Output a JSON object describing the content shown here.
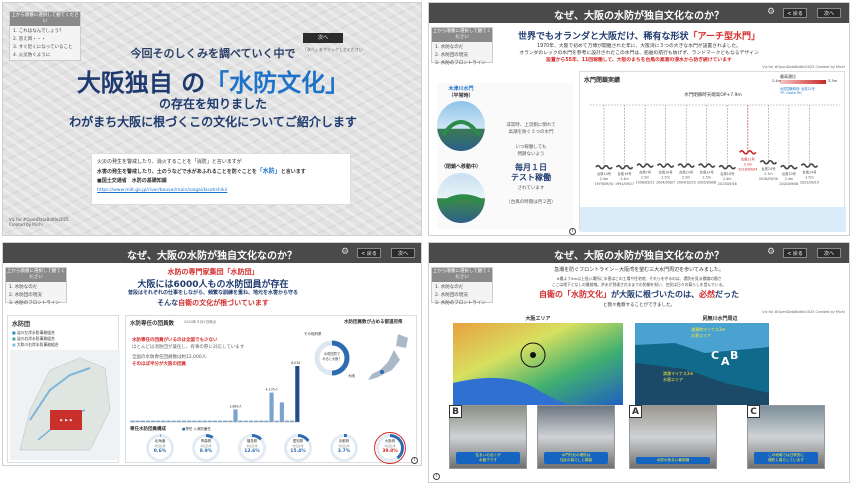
{
  "quiz": {
    "title": "上から順番に選択して\n観てください",
    "title_short": "上から順番に選択して観てください",
    "opts_s1": [
      "1. これはなんでしょう？",
      "2. 答え目・・・",
      "3. すぐ近くになっていること",
      "4. 火災防ぐように"
    ],
    "opts": [
      "1. 水防なのだ",
      "2. 水防団の現況",
      "3. 水防のフロントライン"
    ]
  },
  "s1": {
    "lead": "今回そのしくみを調べていく中で",
    "title_a": "大阪独自 の",
    "title_b": "「水防文化」",
    "sub": "の存在を知りました",
    "tagline": "わがまち大阪に根づくこの文化についてご紹介します",
    "p1": "火災の発生を警戒したり、消火することを「消防」と言いますが",
    "p2a": "水害の発生を警戒したり、土のうなどで水があふれることを防ぐことを",
    "p2b": "「水防」",
    "p2c": "と言います",
    "src": "■国土交通省　水防の基礎知識",
    "url": "https://www.mlit.go.jp/river/bousai/main/saigai/kisotishiki/",
    "credit": "Viz for #OpenDataBattle2025\nCreated by Michi",
    "next": "次へ",
    "next_hint": "「次へ」をクリックしてください"
  },
  "s2": {
    "header": "なぜ、大阪の水防が独自文化なのか？",
    "back": "< 戻る",
    "next": "次へ",
    "h_a": "世界でもオランダと大阪だけ、稀有な形状",
    "h_b": "「アーチ型水門」",
    "l1": "1970年、大阪で初めて万博が開催された年に、大阪湾に３つの大きな水門が設置されました。",
    "l2": "オランダのレックの水門を参考に設計されたこの水門は、船舶の航行も妨げず、ランドマークともなるデザイン",
    "l3": "設置から55年、11回稼働して、大阪のまちを台風の高潮の浸水から防ぎ続けています",
    "credit": "Viz for #OpenDataBattle2025 Created by Michi",
    "gate_name": "木津川水門",
    "gate_state_a": "（平常時）",
    "gate_state_b": "（閉鎖へ移動中）",
    "desc1": "非常時、上流側に倒れて\n高潮を防ぐ３つの水門",
    "desc2": "いつ稼働しても\n問題ないよう",
    "big": "毎月１日\nテスト稼働",
    "desc3": "されています",
    "desc4": "（台風の時期は月２回）",
    "chart_title": "水門閉鎖実績",
    "legend_title": "最高潮位",
    "legend_hi": "3.3m",
    "legend_lo": "2.4m",
    "note": "水防閉鎖時刻: 台風21号\nTP: Osaka Pel.",
    "line_label": "水門閉鎖時天端高OP+7.9m"
  },
  "s2chart": {
    "type": "bar",
    "title": "水門閉鎖実績",
    "labels": [
      "台風10号\n2.4m\n1979/09/30",
      "台風19号\n2.4m\n1991/09/27",
      "台風7号\n2.5m\n1998/09/22",
      "台風18号\n2.5m\n2004/09/07",
      "台風23号\n2.5m\n2004/10/20",
      "台風14号\n2.5m\n2005/09/06",
      "台風18号\n2.4m\n2013/09/16",
      "台風21号\n3.3m\n2018/09/04",
      "台風24号\n2.7m\n2018/09/30",
      "台風10号\n2.4m\n2020/09/06",
      "台風14号\n2.5m\n2022/09/19"
    ],
    "values": [
      2.4,
      2.4,
      2.5,
      2.5,
      2.5,
      2.5,
      2.4,
      3.3,
      2.7,
      2.4,
      2.5
    ],
    "highlight": 7,
    "ylim": [
      0,
      8
    ],
    "threshold": 7.9
  },
  "s3": {
    "header": "なぜ、大阪の水防が独自文化なのか？",
    "back": "< 戻る",
    "next": "次へ",
    "h_a": "水防の専門家集団",
    "h_b": "「水防団」",
    "h2": "大阪には6000人もの水防団員が存在",
    "h3": "普段はそれぞれの仕事をしながら、頻繁な訓練を重ね、地元を水害から守る",
    "h4a": "そんな",
    "h4b": "自衛の文化が根づいています",
    "panel1": "水防団",
    "panel2": "水防専任の団員数",
    "panel2_sub": "2024年４月1日時点",
    "panel3": "水防団員数が占める都道府県",
    "legend": [
      "淀川左岸水防事務組合",
      "淀川右岸水防事務組合",
      "大和川右岸水防事務組合"
    ],
    "callout1": "水防専任の団員がいるのは全国でも少ない",
    "callout2": "ほとんどは消防団が兼任し、有事の際に対応しています",
    "callout3": "全国の水防専任団員数は約12,000人",
    "callout4": "そのほぼ半分が大阪の団員",
    "donut_label": "水防団員で\nみると大阪？",
    "donut_pct_a": "その他府県",
    "donut_pct_b": "大阪",
    "comp_title": "専任水防団員構成",
    "comp_legend": [
      "専任",
      "消防兼任"
    ],
    "comp": [
      {
        "name": "北海道",
        "sub": "専任比率",
        "pct": "0.6%"
      },
      {
        "name": "青森県",
        "sub": "専任比率",
        "pct": "8.9%"
      },
      {
        "name": "福島県",
        "sub": "専任比率",
        "pct": "12.6%"
      },
      {
        "name": "愛知県",
        "sub": "専任比率",
        "pct": "15.4%"
      },
      {
        "name": "京都府",
        "sub": "専任比率",
        "pct": "3.7%"
      },
      {
        "name": "大阪府",
        "sub": "専任比率",
        "pct": "39.8%"
      }
    ],
    "credit": "Viz for #OpenDataBattle2025 Created by Michi"
  },
  "s3chart": {
    "type": "bar",
    "values": [
      1,
      1,
      1,
      1,
      1,
      1,
      1,
      1,
      1,
      1,
      1,
      1,
      1,
      1,
      1,
      1,
      1,
      1,
      1,
      1,
      9,
      1,
      1,
      1,
      1,
      1,
      1,
      21,
      1,
      14,
      1,
      1,
      40
    ],
    "labels": [
      "2,863人",
      "4,135人",
      "6,026人"
    ],
    "highlight": 32
  },
  "s4": {
    "header": "なぜ、大阪の水防が独自文化なのか？",
    "back": "< 戻る",
    "next": "次へ",
    "l1": "急潮を防ぐフロントライン－大阪湾を望む三大水門周辺を歩いてみました。",
    "l2": "※最よう5m以上低い場所に水害はこの工場や住宅地、それらを守るのは、堤防を見る標識の間さ",
    "l3": "ここは地下となしの最前線。洪水が到達されるまでの防御を担い、住民は日々の暮らしを営んでいる。",
    "h_a": "自衛の",
    "h_b": "「水防文化」",
    "h_c": "が大阪に根づいたのは、",
    "h_d": "必然",
    "h_e": "だった",
    "l4": "と我々推察することができました。",
    "credit": "Viz for #OpenDataBattle2025 Created by Michi",
    "map1": "大阪エリア",
    "map2": "尻無川水門周辺",
    "map_note": "満潮時マイナス3m\n水害エリア",
    "map_note2": "満潮マイナス3m\n水害エリア",
    "badge_a": "A",
    "badge_b": "B",
    "badge_c": "C",
    "cap1": "住まいの近くが\n水面下です",
    "cap2": "水門付近の堤防は\n住民の暮らしと隣接",
    "cap3": "水防の危ない最前線",
    "cap4": "この地域では日常的に\n堤防と暮らしています"
  }
}
